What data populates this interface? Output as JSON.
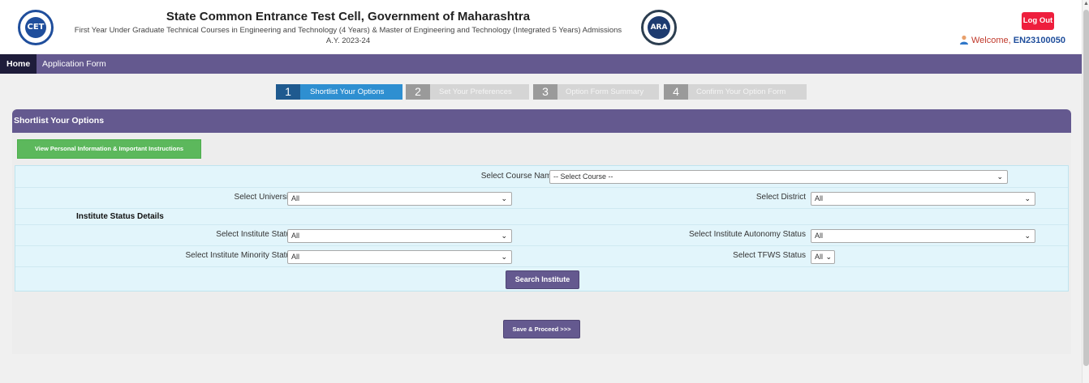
{
  "header": {
    "title": "State Common Entrance Test Cell, Government of Maharashtra",
    "subtitle": "First Year Under Graduate Technical Courses in Engineering and Technology (4 Years) & Master of Engineering and Technology (Integrated 5 Years) Admissions",
    "academic_year": "A.Y. 2023-24",
    "logo_left_text": "CET",
    "logo_right_text": "ARA",
    "logout_label": "Log Out",
    "welcome_prefix": "Welcome, ",
    "user_id": "EN23100050"
  },
  "nav": {
    "home": "Home",
    "application_form": "Application Form"
  },
  "steps": [
    {
      "num": "1",
      "label": "Shortlist Your Options",
      "active": true
    },
    {
      "num": "2",
      "label": "Set Your Preferences",
      "active": false
    },
    {
      "num": "3",
      "label": "Option Form Summary",
      "active": false
    },
    {
      "num": "4",
      "label": "Confirm Your Option Form",
      "active": false
    }
  ],
  "panel": {
    "title": "Shortlist Your Options",
    "info_button": "View Personal Information & Important Instructions"
  },
  "filters": {
    "course_label": "Select Course Name",
    "course_value": "-- Select Course --",
    "university_label": "Select University",
    "university_value": "All",
    "district_label": "Select District",
    "district_value": "All",
    "institute_status_heading": "Institute Status Details",
    "institute_status_label": "Select Institute Status",
    "institute_status_value": "All",
    "autonomy_label": "Select Institute Autonomy Status",
    "autonomy_value": "All",
    "minority_label": "Select Institute Minority Status",
    "minority_value": "All",
    "tfws_label": "Select TFWS Status",
    "tfws_value": "All",
    "search_button": "Search Institute"
  },
  "save_button": "Save & Proceed >>>",
  "colors": {
    "nav_purple": "#64598f",
    "active_step_blue": "#2e8fd1",
    "logout_red": "#ee1e3d",
    "info_green": "#5cb85c",
    "filter_bg": "#e2f5fb"
  }
}
